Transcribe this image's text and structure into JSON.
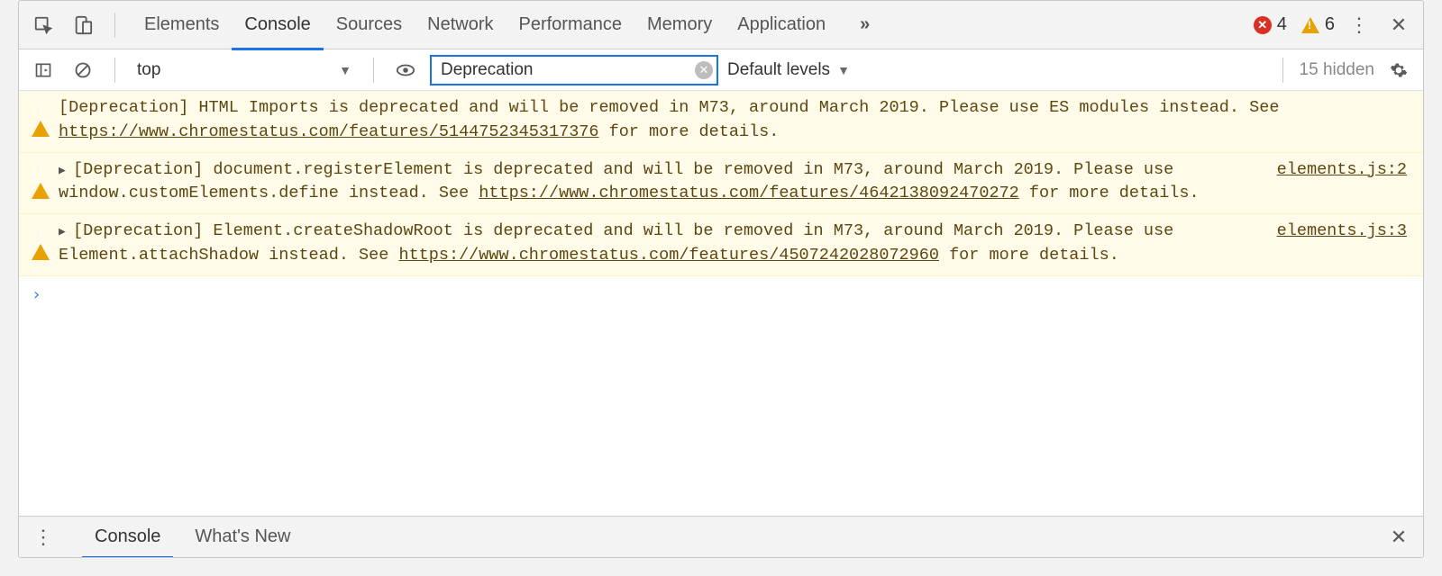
{
  "tabs": {
    "items": [
      "Elements",
      "Console",
      "Sources",
      "Network",
      "Performance",
      "Memory",
      "Application"
    ],
    "active": "Console",
    "overflow_glyph": "»",
    "error_count": "4",
    "warn_count": "6"
  },
  "toolbar": {
    "context": "top",
    "filter_value": "Deprecation",
    "levels_label": "Default levels",
    "hidden_label": "15 hidden"
  },
  "messages": [
    {
      "icon": "warn",
      "expandable": false,
      "text_pre": "[Deprecation] HTML Imports is deprecated and will be removed in M73, around March 2019. Please use ES modules instead. See ",
      "link": "https://www.chromestatus.com/features/5144752345317376",
      "text_post": " for more details.",
      "source": ""
    },
    {
      "icon": "warn",
      "expandable": true,
      "text_pre": "[Deprecation] document.registerElement is deprecated and will be removed in M73, around March 2019. Please use window.customElements.define instead. See ",
      "link": "https://www.chromestatus.com/features/4642138092470272",
      "text_post": " for more details.",
      "source": "elements.js:2"
    },
    {
      "icon": "warn",
      "expandable": true,
      "text_pre": "[Deprecation] Element.createShadowRoot is deprecated and will be removed in M73, around March 2019. Please use Element.attachShadow instead. See ",
      "link": "https://www.chromestatus.com/features/4507242028072960",
      "text_post": " for more details.",
      "source": "elements.js:3"
    }
  ],
  "prompt_glyph": "›",
  "drawer": {
    "items": [
      "Console",
      "What's New"
    ],
    "active": "Console"
  }
}
